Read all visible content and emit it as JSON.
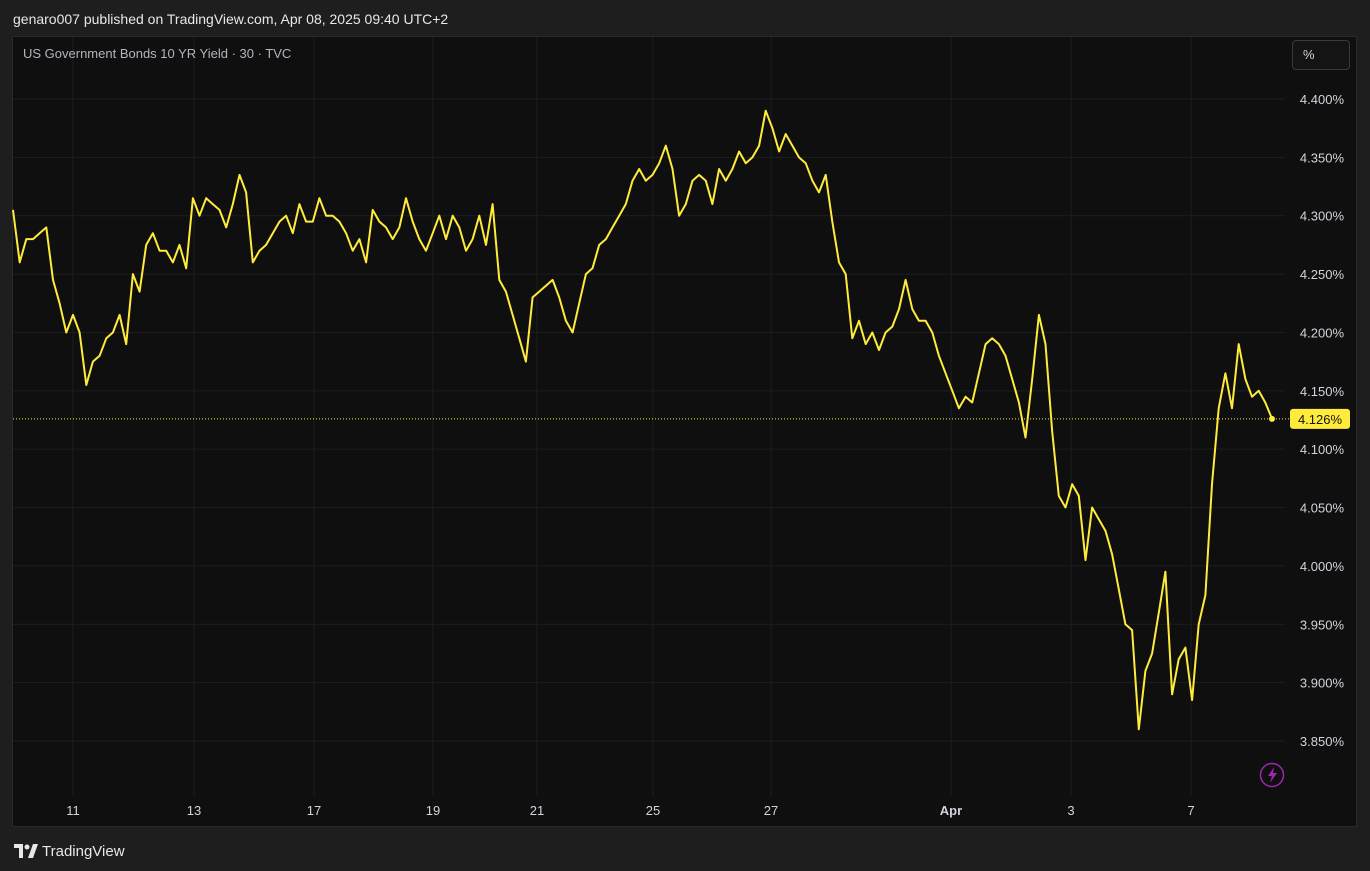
{
  "header": {
    "publish_text": "genaro007 published on TradingView.com, Apr 08, 2025 09:40 UTC+2"
  },
  "symbol_title": "US Government Bonds 10 YR Yield · 30 · TVC",
  "scale_button_label": "%",
  "footer": {
    "brand_label": "TradingView"
  },
  "colors": {
    "line": "#ffeb3b",
    "background": "#0f0f0f",
    "grid": "#1e1e1e",
    "lightning": "#9c27b0"
  },
  "icons": {
    "brand": "tradingview-logo-icon",
    "lightning": "lightning-icon"
  },
  "chart_data": {
    "type": "line",
    "title": "US Government Bonds 10 YR Yield · 30 · TVC",
    "xlabel": "",
    "ylabel": "",
    "ylim": [
      3.83,
      4.42
    ],
    "grid": true,
    "y_ticks": [
      "4.400%",
      "4.350%",
      "4.300%",
      "4.250%",
      "4.200%",
      "4.150%",
      "4.100%",
      "4.050%",
      "4.000%",
      "3.950%",
      "3.900%",
      "3.850%"
    ],
    "x_ticks": [
      "11",
      "13",
      "17",
      "19",
      "21",
      "25",
      "27",
      "Apr",
      "3",
      "7"
    ],
    "last_value_label": "4.126%",
    "series": [
      {
        "values": [
          4.305,
          4.26,
          4.28,
          4.28,
          4.285,
          4.29,
          4.245,
          4.225,
          4.2,
          4.215,
          4.2,
          4.155,
          4.175,
          4.18,
          4.195,
          4.2,
          4.215,
          4.19,
          4.25,
          4.235,
          4.275,
          4.285,
          4.27,
          4.27,
          4.26,
          4.275,
          4.255,
          4.315,
          4.3,
          4.315,
          4.31,
          4.305,
          4.29,
          4.31,
          4.335,
          4.32,
          4.26,
          4.27,
          4.275,
          4.285,
          4.295,
          4.3,
          4.285,
          4.31,
          4.295,
          4.295,
          4.315,
          4.3,
          4.3,
          4.295,
          4.285,
          4.27,
          4.28,
          4.26,
          4.305,
          4.295,
          4.29,
          4.28,
          4.29,
          4.315,
          4.295,
          4.28,
          4.27,
          4.285,
          4.3,
          4.28,
          4.3,
          4.29,
          4.27,
          4.28,
          4.3,
          4.275,
          4.31,
          4.245,
          4.235,
          4.215,
          4.195,
          4.175,
          4.23,
          4.235,
          4.24,
          4.245,
          4.23,
          4.21,
          4.2,
          4.225,
          4.25,
          4.255,
          4.275,
          4.28,
          4.29,
          4.3,
          4.31,
          4.33,
          4.34,
          4.33,
          4.335,
          4.345,
          4.36,
          4.34,
          4.3,
          4.31,
          4.33,
          4.335,
          4.33,
          4.31,
          4.34,
          4.33,
          4.34,
          4.355,
          4.345,
          4.35,
          4.36,
          4.39,
          4.375,
          4.355,
          4.37,
          4.36,
          4.35,
          4.345,
          4.33,
          4.32,
          4.335,
          4.295,
          4.26,
          4.25,
          4.195,
          4.21,
          4.19,
          4.2,
          4.185,
          4.2,
          4.205,
          4.22,
          4.245,
          4.22,
          4.21,
          4.21,
          4.2,
          4.18,
          4.165,
          4.15,
          4.135,
          4.145,
          4.14,
          4.165,
          4.19,
          4.195,
          4.19,
          4.18,
          4.16,
          4.14,
          4.11,
          4.16,
          4.215,
          4.19,
          4.115,
          4.06,
          4.05,
          4.07,
          4.06,
          4.005,
          4.05,
          4.04,
          4.03,
          4.01,
          3.98,
          3.95,
          3.945,
          3.86,
          3.91,
          3.925,
          3.96,
          3.995,
          3.89,
          3.92,
          3.93,
          3.885,
          3.95,
          3.975,
          4.07,
          4.135,
          4.165,
          4.135,
          4.19,
          4.16,
          4.145,
          4.15,
          4.14,
          4.126
        ]
      }
    ]
  }
}
